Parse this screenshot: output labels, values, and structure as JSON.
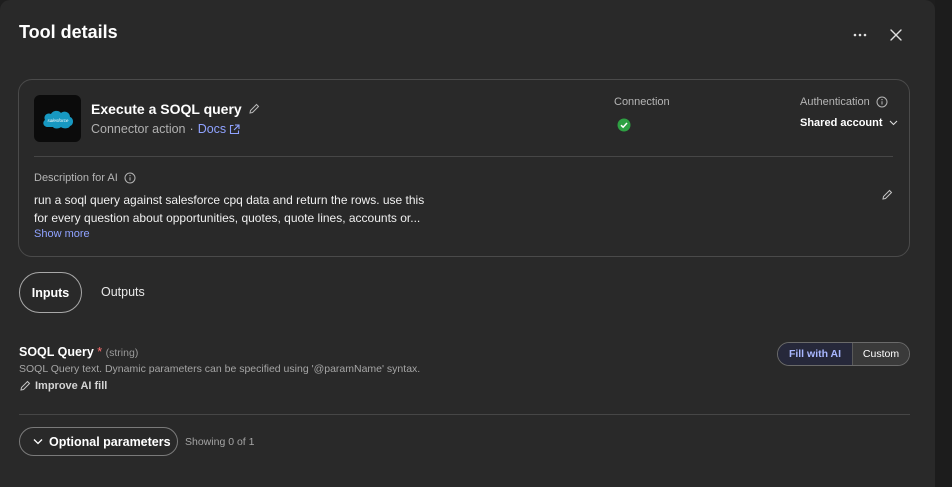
{
  "header": {
    "title": "Tool details",
    "more_icon": "ellipsis-icon",
    "close_icon": "close-icon"
  },
  "tool": {
    "logo_text": "salesforce",
    "logo_color": "#1798c1",
    "name": "Execute a SOQL query",
    "subtitle": "Connector action",
    "separator": "·",
    "docs_label": "Docs",
    "connection_label": "Connection",
    "connection_status": "connected",
    "connection_color": "#2ea043",
    "authentication_label": "Authentication",
    "authentication_value": "Shared account"
  },
  "description": {
    "label": "Description for AI",
    "text_line1": "run a soql query against salesforce cpq data and return the rows. use this",
    "text_line2": "for every question about opportunities, quotes, quote lines, accounts or...",
    "show_more": "Show more"
  },
  "tabs": [
    {
      "label": "Inputs",
      "active": true
    },
    {
      "label": "Outputs",
      "active": false
    }
  ],
  "parameter": {
    "name": "SOQL Query",
    "required_mark": "*",
    "type": "(string)",
    "description": "SOQL Query text. Dynamic parameters can be specified using '@paramName' syntax.",
    "improve_label": "Improve AI fill",
    "mode_options": [
      "Fill with AI",
      "Custom"
    ],
    "selected_mode": "Fill with AI"
  },
  "optional": {
    "button_label": "Optional parameters",
    "showing_text": "Showing 0 of 1"
  },
  "colors": {
    "accent_link": "#8fa2ff",
    "panel_bg": "#292929",
    "required": "#ff6e6e"
  }
}
